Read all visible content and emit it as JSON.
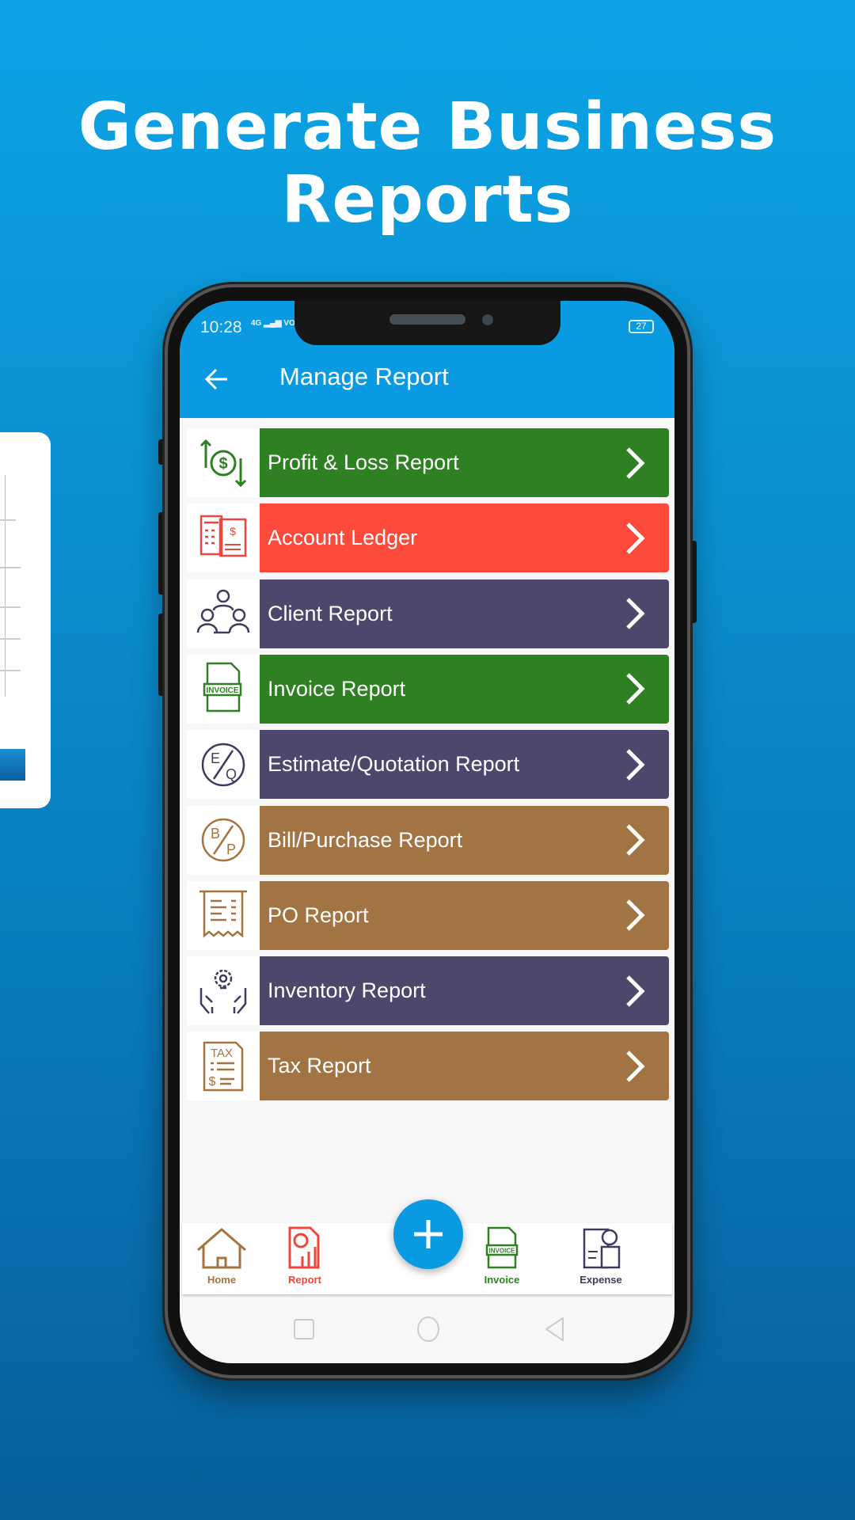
{
  "headline": {
    "line1": "Generate Business",
    "line2": "Reports"
  },
  "status_bar": {
    "time": "10:28",
    "network": "4G",
    "carrier": "VO LTE",
    "battery": "27"
  },
  "app_bar": {
    "title": "Manage Report",
    "back_icon": "arrow-left-icon"
  },
  "reports": [
    {
      "label": "Profit & Loss Report",
      "color": "#2e8023",
      "icon": "profit-loss-icon"
    },
    {
      "label": "Account Ledger",
      "color": "#fd4a3a",
      "icon": "ledger-icon"
    },
    {
      "label": "Client Report",
      "color": "#4e476c",
      "icon": "clients-icon"
    },
    {
      "label": "Invoice Report",
      "color": "#2e8023",
      "icon": "invoice-icon"
    },
    {
      "label": "Estimate/Quotation Report",
      "color": "#4e476c",
      "icon": "estimate-quotation-icon"
    },
    {
      "label": "Bill/Purchase Report",
      "color": "#a37443",
      "icon": "bill-purchase-icon"
    },
    {
      "label": "PO Report",
      "color": "#a37443",
      "icon": "receipt-icon"
    },
    {
      "label": "Inventory Report",
      "color": "#4e476c",
      "icon": "inventory-icon"
    },
    {
      "label": "Tax Report",
      "color": "#a37443",
      "icon": "tax-icon"
    }
  ],
  "bottom_nav": {
    "home": "Home",
    "report": "Report",
    "invoice": "Invoice",
    "expense": "Expense",
    "invoice_icon_text": "INVOICE"
  },
  "icon_text": {
    "eq_e": "E",
    "eq_q": "Q",
    "bp_b": "B",
    "bp_p": "P",
    "tax": "TAX",
    "invoice": "INVOICE"
  }
}
